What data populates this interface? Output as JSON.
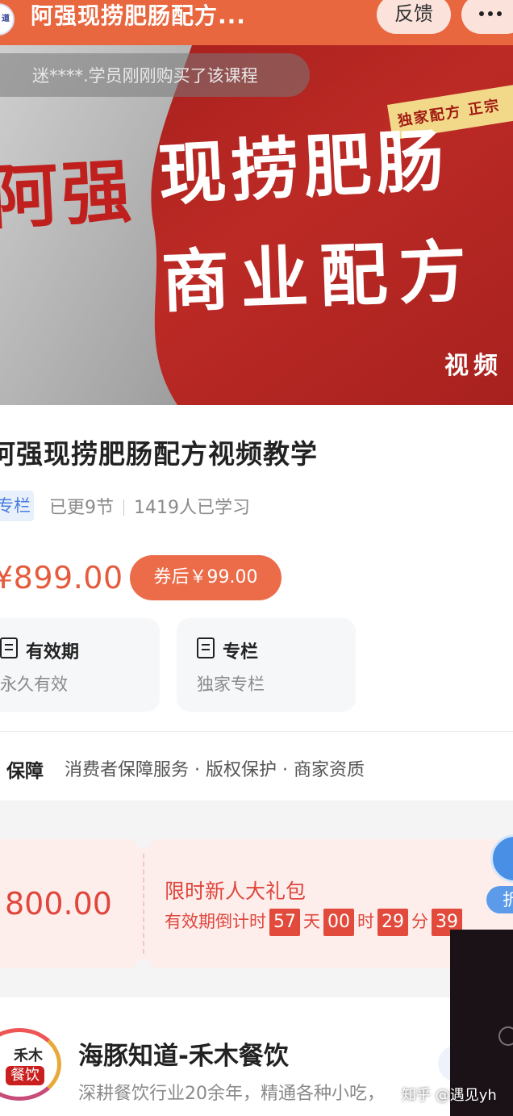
{
  "header": {
    "title": "阿强现捞肥肠配方...",
    "feedback_label": "反馈",
    "logo_text": "道"
  },
  "banner": {
    "toast": "迷****.学员刚刚购买了该课程",
    "ribbon": "独家配方 正宗",
    "line_1a": "阿强",
    "line_1b": "现捞肥肠",
    "line_2": "商业配方",
    "corner": "视频"
  },
  "course": {
    "title": "阿强现捞肥肠配方视频教学",
    "tag": "专栏",
    "updated": "已更9节",
    "learners": "1419人已学习",
    "price": "¥899.00",
    "coupon_price": "券后￥99.00"
  },
  "cards": [
    {
      "title": "有效期",
      "sub": "永久有效"
    },
    {
      "title": "专栏",
      "sub": "独家专栏"
    }
  ],
  "guarantee": {
    "label": "保障",
    "text": "消费者保障服务 · 版权保护 · 商家资质"
  },
  "voucher": {
    "amount": "800.00",
    "title": "限时新人大礼包",
    "countdown_label": "有效期倒计时",
    "days": "57",
    "days_unit": "天",
    "hours": "00",
    "hours_unit": "时",
    "minutes": "29",
    "minutes_unit": "分",
    "seconds": "39"
  },
  "float_pill": "折",
  "shop": {
    "logo_top": "禾木",
    "logo_bottom": "餐饮",
    "name": "海豚知道-禾木餐饮",
    "desc": "深耕餐饮行业20余年，精通各种小吃，"
  },
  "watermark": "知乎 @遇见yh",
  "colors": {
    "header": "#e9673f",
    "accent": "#e55b3d",
    "banner_red": "#b32622",
    "voucher_bg": "#fdeeec"
  }
}
